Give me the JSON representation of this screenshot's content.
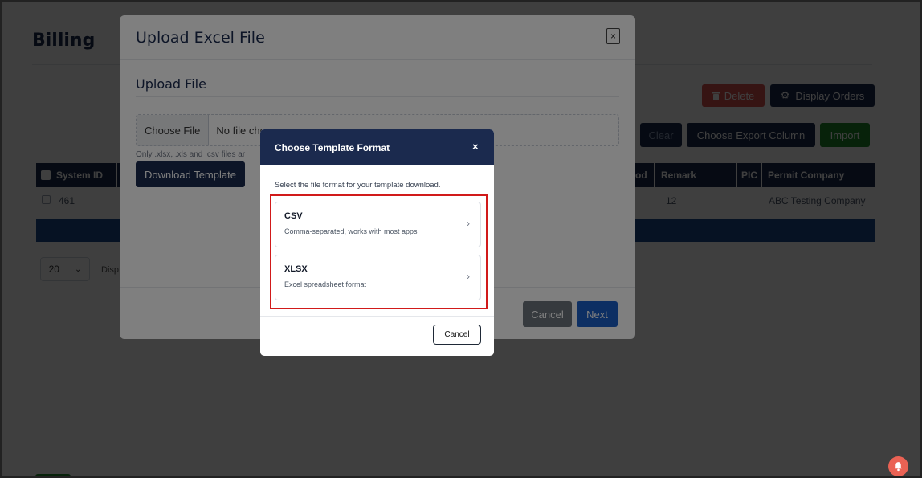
{
  "page": {
    "title": "Billing",
    "delete_label": "Delete",
    "display_orders_label": "Display Orders",
    "clear_label": "Clear",
    "choose_export_label": "Choose Export Column",
    "import_label": "Import",
    "table": {
      "columns": [
        "System ID",
        "od",
        "Remark",
        "PIC",
        "Permit Company"
      ],
      "rows": [
        {
          "system_id": "461",
          "remark": "12",
          "permit_company": "ABC Testing Company"
        }
      ]
    },
    "page_size": "20",
    "display_text": "Disp"
  },
  "upload_modal": {
    "title": "Upload Excel File",
    "close_glyph": "×",
    "section_title": "Upload File",
    "choose_file_label": "Choose File",
    "no_file_text": "No file chosen",
    "note": "Only .xlsx, .xls and .csv files ar",
    "download_template_label": "Download Template",
    "cancel_label": "Cancel",
    "next_label": "Next"
  },
  "template_dialog": {
    "title": "Choose Template Format",
    "close_glyph": "×",
    "description": "Select the file format for your template download.",
    "options": [
      {
        "name": "CSV",
        "description": "Comma-separated, works with most apps",
        "chevron": "›"
      },
      {
        "name": "XLSX",
        "description": "Excel spreadsheet format",
        "chevron": "›"
      }
    ],
    "cancel_label": "Cancel",
    "highlight_color": "#d11a1a"
  },
  "colors": {
    "navy": "#1b2a4e",
    "danger": "#d9534f",
    "success": "#1d8a2a",
    "primary": "#1a5ec7",
    "secondary": "#6c757d"
  },
  "icons": [
    "trash-icon",
    "gear-icon",
    "chevron-down-icon",
    "chevron-right-icon",
    "close-icon",
    "bell-icon"
  ]
}
